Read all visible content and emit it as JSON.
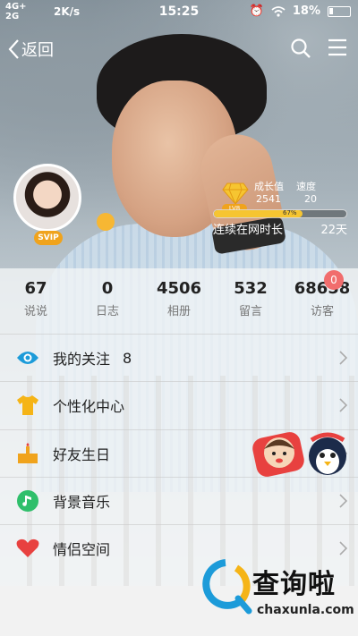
{
  "status_bar": {
    "network": "4G+",
    "network2": "2G",
    "speed": "2K/s",
    "time": "15:25",
    "battery": "18%"
  },
  "header": {
    "back_label": "返回"
  },
  "profile": {
    "vip_label": "SVIP"
  },
  "growth": {
    "label_growth": "成长值",
    "label_speed": "速度",
    "growth_value": "2541",
    "speed_value": "20",
    "level_badge": "LV8",
    "progress_percent": 67,
    "progress_text": "67%",
    "online_label": "连续在网时长",
    "online_days": "22天"
  },
  "stats": [
    {
      "value": "67",
      "label": "说说"
    },
    {
      "value": "0",
      "label": "日志"
    },
    {
      "value": "4506",
      "label": "相册"
    },
    {
      "value": "532",
      "label": "留言"
    },
    {
      "value": "68658",
      "label": "访客"
    }
  ],
  "visitor_badge": "0",
  "menu": [
    {
      "label": "我的关注",
      "count": "8",
      "icon": "eye-icon"
    },
    {
      "label": "个性化中心",
      "count": "",
      "icon": "tshirt-icon"
    },
    {
      "label": "好友生日",
      "count": "",
      "icon": "cake-icon"
    },
    {
      "label": "背景音乐",
      "count": "",
      "icon": "music-icon"
    },
    {
      "label": "情侣空间",
      "count": "",
      "icon": "heart-icon"
    }
  ],
  "watermark": {
    "text": "查询啦",
    "url": "chaxunla.com"
  },
  "colors": {
    "eye": "#1c9bd9",
    "tshirt": "#f5b417",
    "cake": "#f0a31c",
    "music": "#2fbf6b",
    "heart": "#e8413f"
  }
}
